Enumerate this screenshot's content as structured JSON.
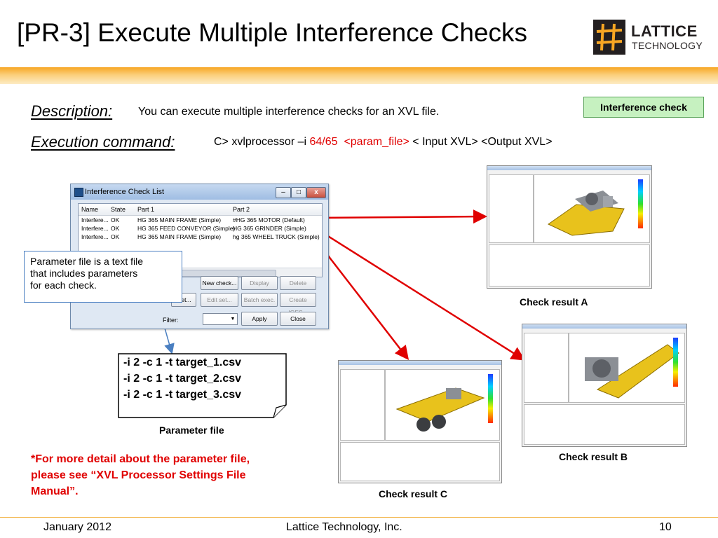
{
  "slide": {
    "title": "[PR-3] Execute Multiple Interference Checks",
    "logo": {
      "line1": "LATTICE",
      "line2": "TECHNOLOGY"
    },
    "description_label": "Description:",
    "description_text": "You can execute multiple interference checks for an XVL file.",
    "execution_label": "Execution command:",
    "command": {
      "part1": "C> xvlprocessor –i ",
      "part2": "64/65",
      "part3": "<param_file>",
      "part4": " < Input XVL> <Output XVL>"
    },
    "badge": "Interference check",
    "colors": {
      "accent_bar": "#f7a623",
      "highlight_text": "#e00000",
      "arrow": "#e00000",
      "callout_border": "#4a7fc1"
    }
  },
  "dialog": {
    "title": "Interference Check List",
    "window_buttons": [
      "–",
      "□",
      "x"
    ],
    "columns": [
      "Name",
      "State",
      "Part 1",
      "Part 2"
    ],
    "rows": [
      [
        "Interfere...",
        "OK",
        "HG 365 MAIN FRAME (Simple)",
        "#HG 365 MOTOR (Default)"
      ],
      [
        "Interfere...",
        "OK",
        "HG 365 FEED CONVEYOR (Simple)",
        "HG 365 GRINDER (Simple)"
      ],
      [
        "Interfere...",
        "OK",
        "HG 365 MAIN FRAME (Simple)",
        "hg 365 WHEEL TRUCK (Simple)"
      ]
    ],
    "buttons": {
      "new_check": "New check...",
      "display": "Display",
      "delete": "Delete",
      "set": "...et...",
      "edit_set": "Edit set...",
      "batch_exec": "Batch exec.",
      "create_iges": "Create IGES...",
      "apply": "Apply",
      "close": "Close"
    },
    "filter_label": "Filter:"
  },
  "callout": {
    "lines": [
      "Parameter file is a text file",
      "that includes parameters",
      "for each check."
    ]
  },
  "param_note": {
    "lines": [
      "-i 2 -c 1 -t target_1.csv",
      "-i 2 -c 1 -t target_2.csv",
      "-i 2 -c 1 -t target_3.csv"
    ],
    "caption": "Parameter file"
  },
  "red_note": {
    "lines": [
      "*For more detail about the parameter file,",
      "please see “XVL Processor Settings File",
      "Manual”."
    ]
  },
  "results": {
    "a": "Check result  A",
    "b": "Check result  B",
    "c": "Check result  C"
  },
  "footer": {
    "date": "January 2012",
    "company": "Lattice Technology, Inc.",
    "page": "10"
  }
}
